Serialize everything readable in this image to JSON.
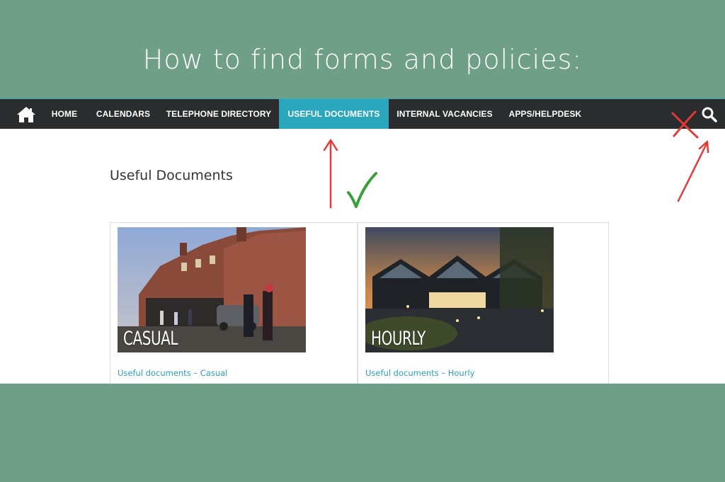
{
  "headline": "How to find forms and policies:",
  "nav": {
    "home_icon": "home-icon",
    "items": [
      {
        "label": "HOME"
      },
      {
        "label": "CALENDARS"
      },
      {
        "label": "TELEPHONE DIRECTORY"
      },
      {
        "label": "USEFUL DOCUMENTS",
        "active": true
      },
      {
        "label": "INTERNAL VACANCIES"
      },
      {
        "label": "APPS/HELPDESK"
      }
    ],
    "search_icon": "search-icon",
    "active_color": "#2aa7bd",
    "bar_color": "#2b2c2e"
  },
  "page": {
    "title": "Useful Documents",
    "cards": [
      {
        "image_label": "CASUAL",
        "link": "Useful documents – Casual"
      },
      {
        "image_label": "HOURLY",
        "link": "Useful documents – Hourly"
      }
    ]
  },
  "annotations": {
    "check_icon": "check-mark-icon",
    "cross_icon": "cross-mark-icon",
    "arrow_icon": "arrow-icon",
    "check_color": "#3a9e3a",
    "arrow_color": "#e53935"
  },
  "colors": {
    "background": "#6f9f86",
    "link": "#2a9fba"
  }
}
